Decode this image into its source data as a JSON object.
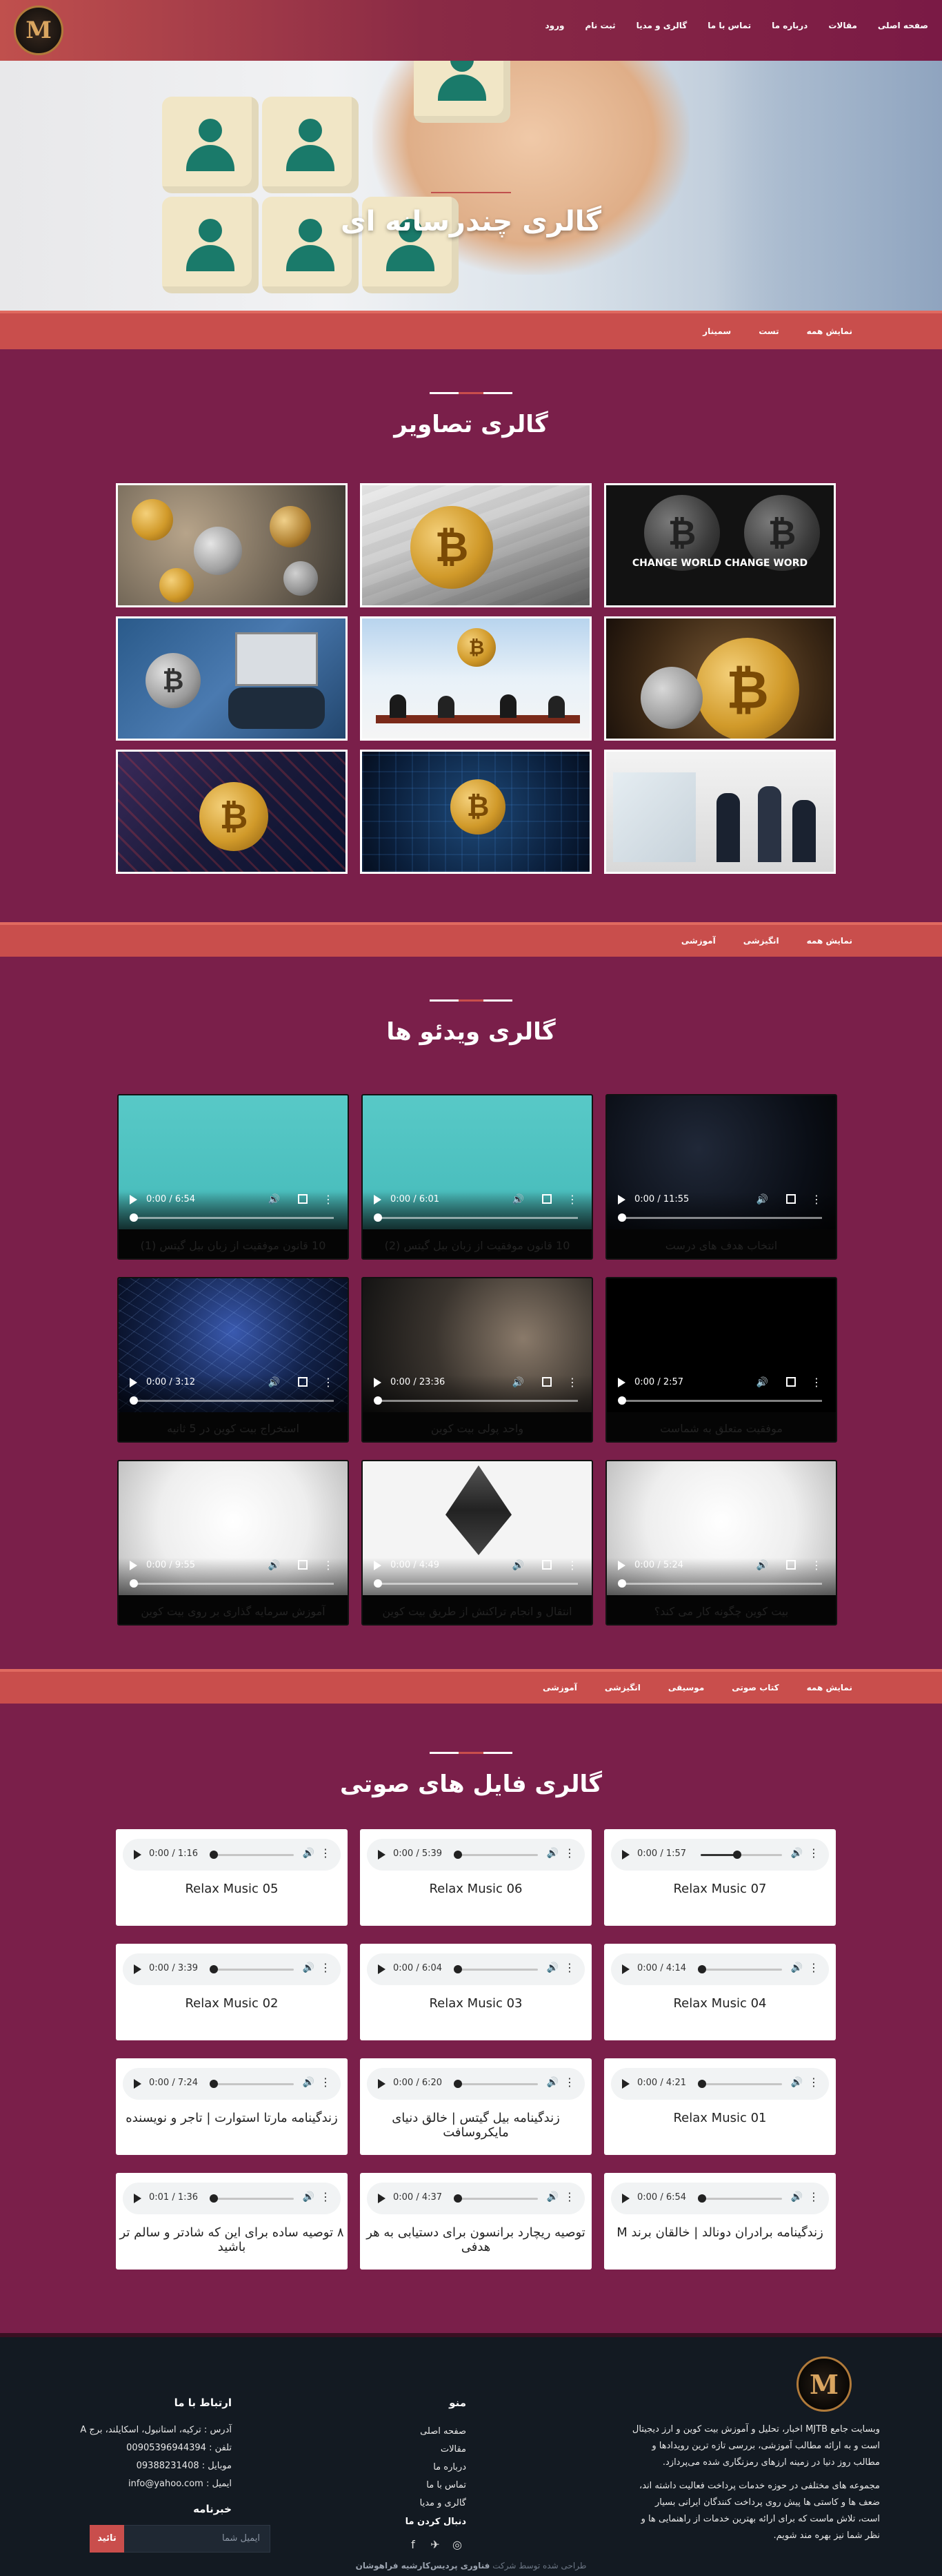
{
  "nav": [
    "صفحه اصلی",
    "مقالات",
    "درباره ما",
    "تماس با ما",
    "گالری و مدیا",
    "ثبت نام",
    "ورود"
  ],
  "logo_text": "M",
  "hero_title": "گالری چندرسانه ای",
  "image_tabs": [
    "نمایش همه",
    "تست",
    "سمینار"
  ],
  "image_section_title": "گالری تصاویر",
  "image_caption": "CHANGE WORLD CHANGE WORD",
  "video_tabs": [
    "نمایش همه",
    "انگیزشی",
    "آموزشی"
  ],
  "video_section_title": "گالری ویدئو ها",
  "videos": [
    {
      "time": "0:00 / 6:54",
      "title": "10 قانون موفقیت از زبان بیل گیتس (1)"
    },
    {
      "time": "0:00 / 6:01",
      "title": "10 قانون موفقیت از زبان بیل گیتس (2)"
    },
    {
      "time": "0:00 / 11:55",
      "title": "انتخاب هدف های درست"
    },
    {
      "time": "0:00 / 3:12",
      "title": "استخراج بیت کوین در 5 ثانیه"
    },
    {
      "time": "0:00 / 23:36",
      "title": "واحد پولی بیت کوین"
    },
    {
      "time": "0:00 / 2:57",
      "title": "موفقیت متعلق به شماست"
    },
    {
      "time": "0:00 / 9:55",
      "title": "آموزش سرمایه گذاری بر روی بیت کوین"
    },
    {
      "time": "0:00 / 4:49",
      "title": "انتقال و انجام تراکنش از طریق بیت کوین"
    },
    {
      "time": "0:00 / 5:24",
      "title": "بیت کوین چگونه کار می کند؟"
    }
  ],
  "audio_tabs": [
    "نمایش همه",
    "کتاب صوتی",
    "موسیقی",
    "انگیزشی",
    "آموزشی"
  ],
  "audio_section_title": "گالری فایل های صوتی",
  "audios": [
    {
      "time": "0:00 / 1:16",
      "title": "Relax Music 05",
      "progress": 0.02
    },
    {
      "time": "0:00 / 5:39",
      "title": "Relax Music 06",
      "progress": 0.02
    },
    {
      "time": "0:00 / 1:57",
      "title": "Relax Music 07",
      "progress": 0.45
    },
    {
      "time": "0:00 / 3:39",
      "title": "Relax Music 02",
      "progress": 0.02
    },
    {
      "time": "0:00 / 6:04",
      "title": "Relax Music 03",
      "progress": 0.02
    },
    {
      "time": "0:00 / 4:14",
      "title": "Relax Music 04",
      "progress": 0.02
    },
    {
      "time": "0:00 / 7:24",
      "title": "زندگینامه مارتا استوارت | تاجر و نویسنده",
      "progress": 0.02
    },
    {
      "time": "0:00 / 6:20",
      "title": "زندگینامه بیل گیتس | خالق دنیای مایکروسافت",
      "progress": 0.02
    },
    {
      "time": "0:00 / 4:21",
      "title": "Relax Music 01",
      "progress": 0.02
    },
    {
      "time": "0:01 / 1:36",
      "title": "۸ توصیه ساده برای این که شادتر و سالم تر باشید",
      "progress": 0.02
    },
    {
      "time": "0:00 / 4:37",
      "title": "توصیه ریچارد برانسون برای دستیابی به هر هدفی",
      "progress": 0.02
    },
    {
      "time": "0:00 / 6:54",
      "title": "زندگینامه برادران دونالد | خالقان برند M",
      "progress": 0.02
    }
  ],
  "footer": {
    "about_1": "وبسایت جامع MJTB اخبار، تحلیل و آموزش بیت کوین و ارز دیجیتال است و به ارائه مطالب آموزشی، بررسی تازه ترین رویدادها و مطالب روز دنیا در زمینه ارزهای رمزنگاری شده می‌پردازد.",
    "about_2": "مجموعه های مختلفی در حوزه خدمات پرداخت فعالیت داشته اند، ضعف ها و کاستی ها پیش روی پرداخت کنندگان ایرانی بسیار است، تلاش ماست که برای ارائه بهترین خدمات از راهنمایی ها و نظر شما نیز بهره مند شویم.",
    "menu_title": "منو",
    "menu": [
      "صفحه اصلی",
      "مقالات",
      "درباره ما",
      "تماس با ما",
      "گالری و مدیا"
    ],
    "follow": "دنبال کردن ما",
    "contact_title": "ارتباط با ما",
    "contact": [
      "آدرس : ترکیه، استانبول، اسکایلند، برج A",
      "تلفن : 00905396944394",
      "موبایل : 09388231408",
      "ایمیل : info@yahoo.com"
    ],
    "newsletter": "خبرنامه",
    "email_placeholder": "ایمیل شما",
    "submit": "تائید",
    "copy_prefix": "طراحی شده توسط شرکت",
    "copy_brand": "فناوری پردیس‌کارشیه فراهوشان"
  }
}
